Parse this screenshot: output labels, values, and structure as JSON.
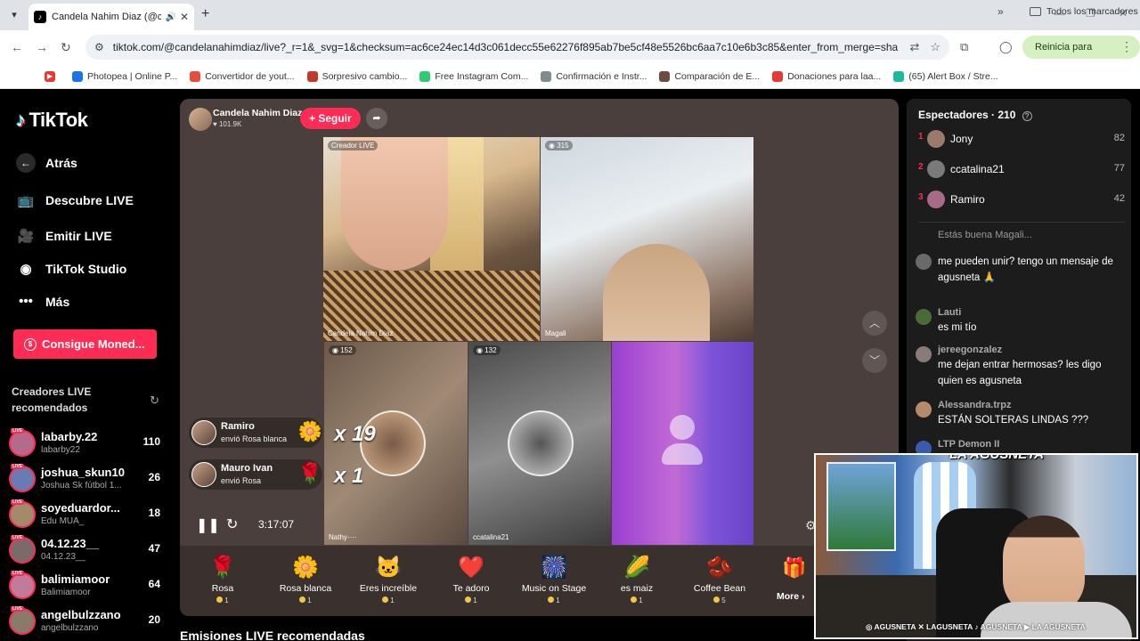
{
  "browser": {
    "tab_title": "Candela Nahim Diaz (@can",
    "url": "tiktok.com/@candelanahimdiaz/live?_r=1&_svg=1&checksum=ac6ce24ec14d3c061decc55e62276f895ab7be5cf48e5526bc6aa7c10e6b3c85&enter_from_merge=share&enter_...",
    "update_label": "Reinicia para actualizar",
    "bookmarks": [
      {
        "label": "Photopea | Online P...",
        "color": "#1a73e8"
      },
      {
        "label": "Convertidor de yout...",
        "color": "#e74c3c"
      },
      {
        "label": "Sorpresivo cambio...",
        "color": "#c0392b"
      },
      {
        "label": "Free Instagram Com...",
        "color": "#2ecc71"
      },
      {
        "label": "Confirmación e Instr...",
        "color": "#7f8c8d"
      },
      {
        "label": "Comparación de E...",
        "color": "#6d4c41"
      },
      {
        "label": "Donaciones para laa...",
        "color": "#e53935"
      },
      {
        "label": "(65) Alert Box / Stre...",
        "color": "#1abc9c"
      }
    ],
    "all_bookmarks": "Todos los marcadores"
  },
  "sidebar": {
    "logo": "TikTok",
    "nav": [
      {
        "label": "Atrás",
        "icon": "back-arrow"
      },
      {
        "label": "Descubre LIVE",
        "icon": "tv"
      },
      {
        "label": "Emitir LIVE",
        "icon": "camera"
      },
      {
        "label": "TikTok Studio",
        "icon": "studio"
      },
      {
        "label": "Más",
        "icon": "more"
      }
    ],
    "coins_button": "Consigue Moned...",
    "recommended_header": "Creadores LIVE recomendados",
    "creators": [
      {
        "name": "labarby.22",
        "sub": "labarby22",
        "count": "110",
        "color": "#b56a8c"
      },
      {
        "name": "joshua_skun10",
        "sub": "Joshua Sk fútbol 1...",
        "count": "26",
        "color": "#6a7ab5"
      },
      {
        "name": "soyeduardor...",
        "sub": "Edu MUA_",
        "count": "18",
        "color": "#a28a6a"
      },
      {
        "name": "04.12.23__",
        "sub": "04.12.23__",
        "count": "47",
        "color": "#7a6a6a"
      },
      {
        "name": "balimiamoor",
        "sub": "Balimiamoor",
        "count": "64",
        "color": "#c27a9a"
      },
      {
        "name": "angelbulzzano",
        "sub": "angelbulzzano",
        "count": "20",
        "color": "#8a7a6a"
      }
    ]
  },
  "stage": {
    "host_name": "Candela Nahim Diaz",
    "host_likes": "101.9K",
    "follow": "+ Seguir",
    "cells": {
      "host_tag": "Creador LIVE",
      "host_name": "Candela Nahim Diaz",
      "magali_count": "315",
      "magali_name": "Magali",
      "nathy_count": "152",
      "nathy_name": "Nathy····",
      "cata_count": "132",
      "cata_name": "ccatalina21"
    },
    "gift_notifs": [
      {
        "name": "Ramiro",
        "text": "envió Rosa blanca",
        "icon": "🌼",
        "combo": "x 19"
      },
      {
        "name": "Mauro Ivan",
        "text": "envió Rosa",
        "icon": "🌹",
        "combo": "x 1"
      }
    ],
    "timer": "3:17:07",
    "gifts": [
      {
        "name": "Rosa",
        "icon": "🌹",
        "price": "1"
      },
      {
        "name": "Rosa blanca",
        "icon": "🌼",
        "price": "1"
      },
      {
        "name": "Eres increíble",
        "icon": "🐱",
        "price": "1"
      },
      {
        "name": "Te adoro",
        "icon": "❤️",
        "price": "1"
      },
      {
        "name": "Music on Stage",
        "icon": "🎆",
        "price": "1"
      },
      {
        "name": "es maiz",
        "icon": "🌽",
        "price": "1"
      },
      {
        "name": "Coffee Bean",
        "icon": "🫘",
        "price": "5"
      }
    ],
    "more_gifts": "More ›"
  },
  "section_title": "Emisiones LIVE recomendadas",
  "right_panel": {
    "viewers_label": "Espectadores",
    "viewers_count": "· 210",
    "top_viewers": [
      {
        "rank": "1",
        "name": "Jony",
        "score": "82",
        "color": "#9a7a6a"
      },
      {
        "rank": "2",
        "name": "ccatalina21",
        "score": "77",
        "color": "#7a7a7a"
      },
      {
        "rank": "3",
        "name": "Ramiro",
        "score": "42",
        "color": "#a86a8a"
      }
    ],
    "partial_text": "Estás buena Magali...",
    "chat": [
      {
        "user": "",
        "message": "me pueden unir? tengo un mensaje de agusneta 🙏",
        "color": "#6a6a6a"
      },
      {
        "user": "Lauti",
        "message": "es mi tío",
        "color": "#4a6a3a"
      },
      {
        "user": "jereegonzalez",
        "message": "me dejan entrar hermosas? les digo quien es agusneta",
        "color": "#8a7a7a"
      },
      {
        "user": "Alessandra.trpz",
        "message": "ESTÁN SOLTERAS LINDAS ???",
        "color": "#b58a6a"
      },
      {
        "user": "LTP Demon II",
        "message": "",
        "color": "#3a5ab0"
      }
    ]
  },
  "webcam": {
    "logo": "LA AGUSNETA",
    "socials": "◎ AGUSNETA  ✕ LAGUSNETA  ♪ AGUSNETA  ▶ LA AGUSNETA"
  }
}
